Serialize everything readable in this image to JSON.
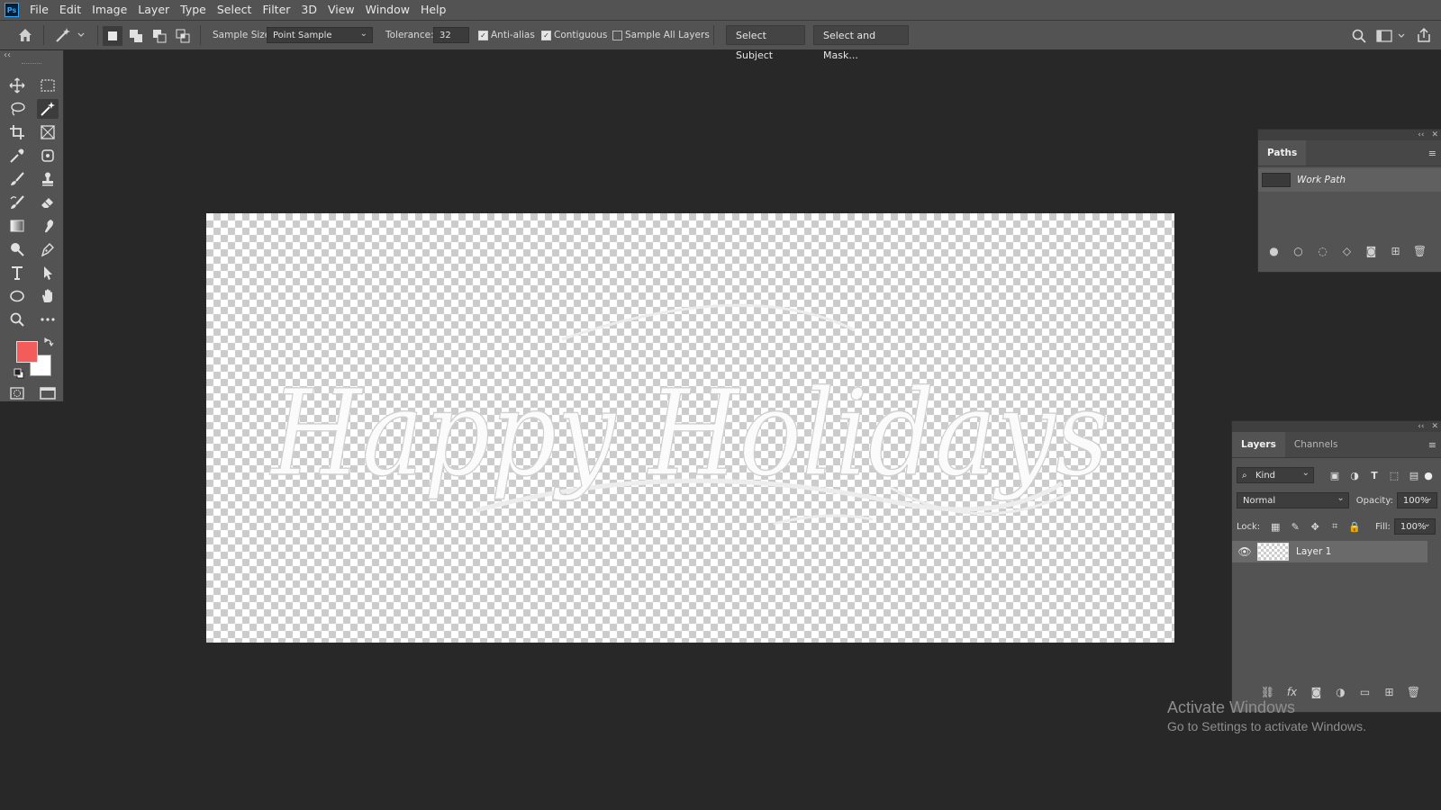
{
  "app": {
    "logo": "Ps"
  },
  "menu": [
    "File",
    "Edit",
    "Image",
    "Layer",
    "Type",
    "Select",
    "Filter",
    "3D",
    "View",
    "Window",
    "Help"
  ],
  "options_bar": {
    "sample_size_label": "Sample Size:",
    "sample_size_value": "Point Sample",
    "tolerance_label": "Tolerance:",
    "tolerance_value": "32",
    "anti_alias_label": "Anti-alias",
    "anti_alias_checked": true,
    "contiguous_label": "Contiguous",
    "contiguous_checked": true,
    "sample_all_layers_label": "Sample All Layers",
    "sample_all_layers_checked": false,
    "select_subject": "Select Subject",
    "select_and_mask": "Select and Mask..."
  },
  "colors": {
    "foreground": "#f45b5b",
    "background": "#ffffff",
    "panel": "#535353",
    "workspace": "#282828"
  },
  "canvas": {
    "text": "Happy Holidays"
  },
  "paths_panel": {
    "tab": "Paths",
    "items": [
      {
        "name": "Work Path"
      }
    ]
  },
  "layers_panel": {
    "tabs": [
      "Layers",
      "Channels"
    ],
    "filter_kind": "Kind",
    "blend_mode": "Normal",
    "opacity_label": "Opacity:",
    "opacity_value": "100%",
    "lock_label": "Lock:",
    "fill_label": "Fill:",
    "fill_value": "100%",
    "layers": [
      {
        "name": "Layer 1",
        "visible": true
      }
    ]
  },
  "watermark": {
    "line1": "Activate Windows",
    "line2": "Go to Settings to activate Windows."
  }
}
